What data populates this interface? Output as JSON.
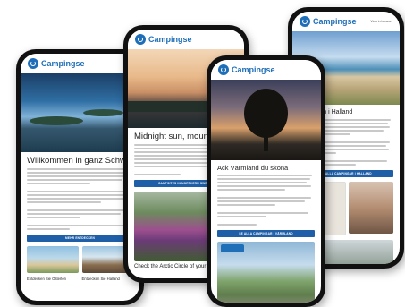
{
  "brand": {
    "name": "Campingse",
    "accent": "#1f5fa8"
  },
  "phones": {
    "p1": {
      "title": "Willkommen in ganz Schweden!",
      "cta": "MEHR ENTDECKEN",
      "captions": [
        "Entdecken Sie Österlen",
        "Entdecken Sie Halland"
      ]
    },
    "p2": {
      "title": "Midnight sun, mountains and w",
      "cta": "CAMPSITES IN NORTHERN SWEDEN",
      "caption": "Check the Arctic Circle of your bucket"
    },
    "p3": {
      "title": "Ack Värmland du sköna",
      "cta": "SE ALLA CAMPINGAR I VÄRMLAND"
    },
    "p4": {
      "link": "View in browser",
      "title": "Möt våren i Halland",
      "cta": "SE ALLA CAMPINGAR I HALLAND"
    }
  }
}
